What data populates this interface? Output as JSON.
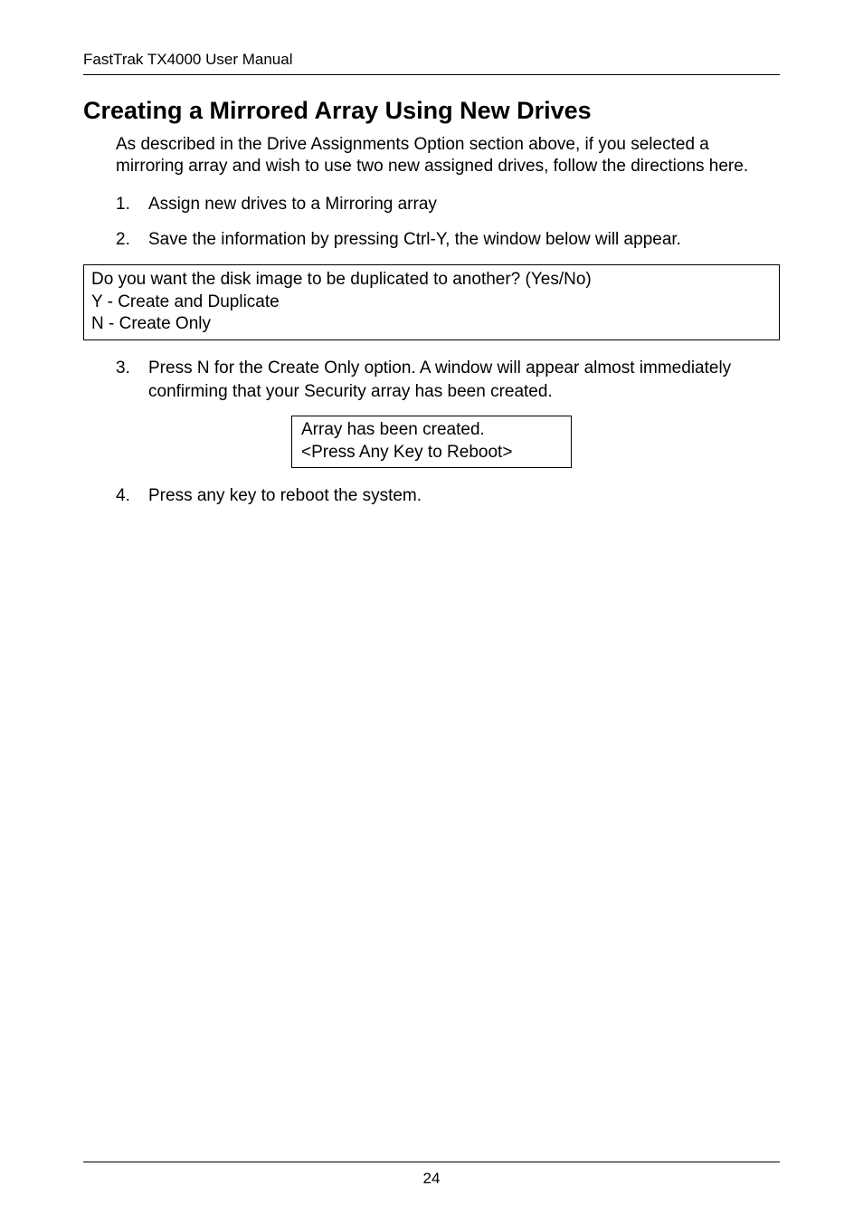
{
  "header": {
    "title": "FastTrak TX4000 User Manual"
  },
  "section": {
    "heading": "Creating a Mirrored Array Using New Drives",
    "intro": "As described in the Drive Assignments Option section above, if you selected a mirroring array and wish to use two new assigned drives, follow the directions here."
  },
  "steps": {
    "s1": {
      "num": "1.",
      "text": "Assign new drives to a Mirroring array"
    },
    "s2": {
      "num": "2.",
      "text": "Save the information by pressing Ctrl-Y, the window below will appear."
    },
    "s3": {
      "num": "3.",
      "text": "Press N for the Create Only option. A window will appear almost immediately confirming that your Security array has been created."
    },
    "s4": {
      "num": "4.",
      "text": "Press any key to reboot the system."
    }
  },
  "box1": {
    "line1": "Do you want the disk image to be duplicated to another? (Yes/No)",
    "line2": "Y - Create and Duplicate",
    "line3": "N - Create Only"
  },
  "box2": {
    "line1": "Array has been created.",
    "line2": "<Press Any Key to Reboot>"
  },
  "footer": {
    "page_number": "24"
  }
}
